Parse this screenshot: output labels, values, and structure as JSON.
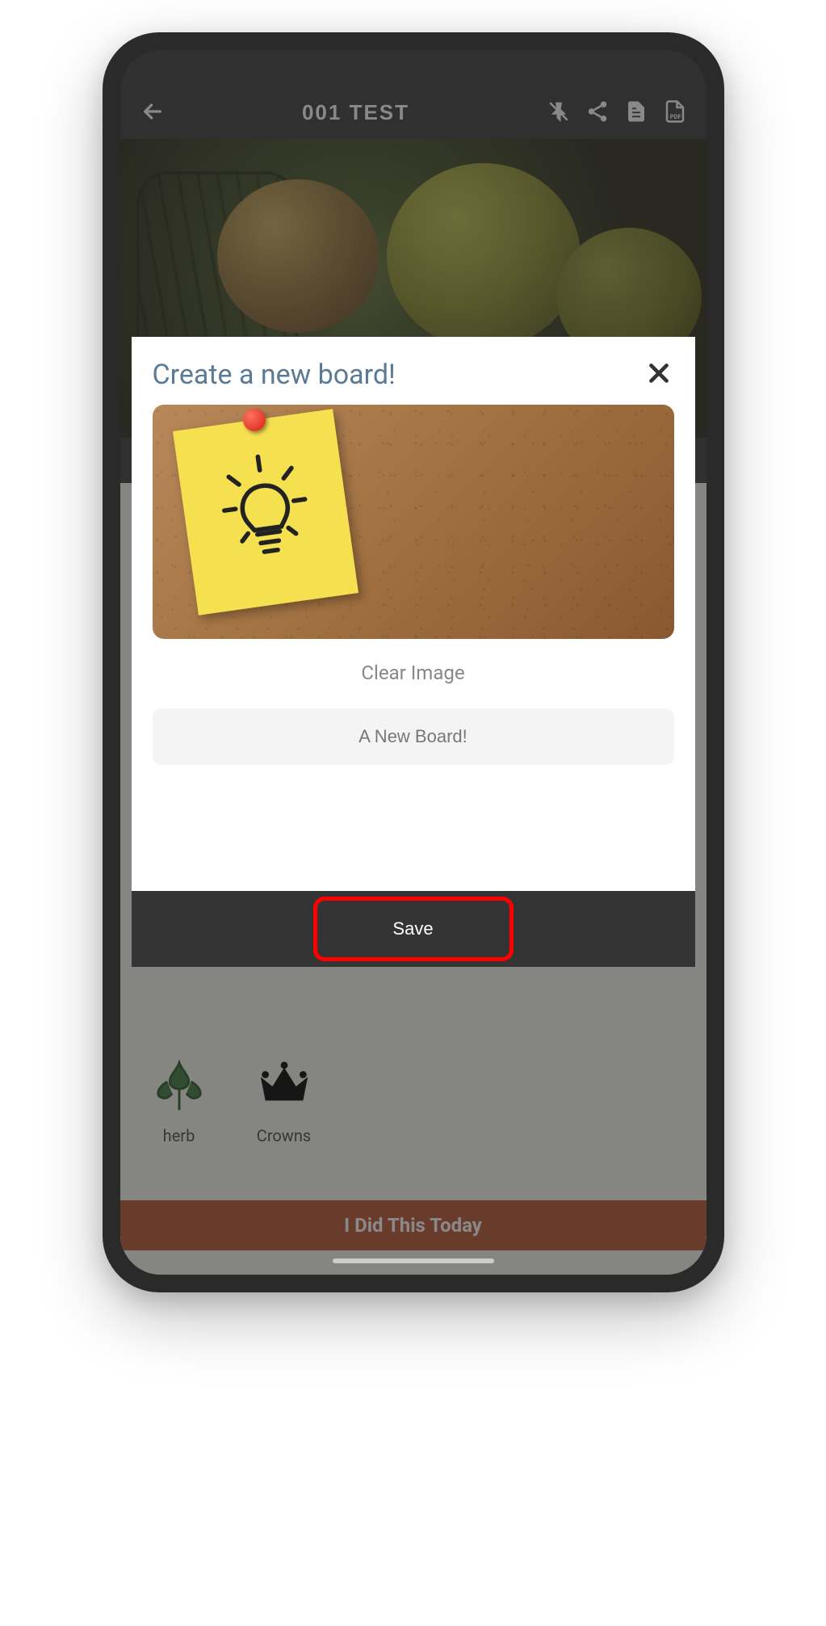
{
  "header": {
    "title": "001 TEST"
  },
  "modal": {
    "title": "Create a new board!",
    "clear_image_label": "Clear Image",
    "board_name_value": "A New Board!",
    "save_label": "Save"
  },
  "background": {
    "categories": [
      {
        "label": "herb",
        "icon": "herb-icon"
      },
      {
        "label": "Crowns",
        "icon": "crown-icon"
      }
    ],
    "footer_button": "I Did This Today"
  }
}
